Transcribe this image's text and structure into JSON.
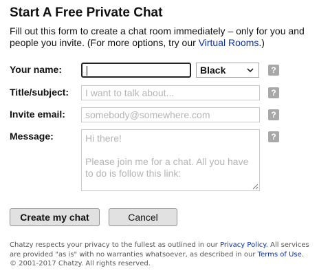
{
  "header": {
    "title": "Start A Free Private Chat",
    "intro_text": "Fill out this form to create a chat room immediately – only for you and people you invite. (For more options, try our ",
    "intro_link": "Virtual Rooms",
    "intro_end": ".)"
  },
  "form": {
    "name": {
      "label": "Your name:",
      "value": ""
    },
    "color": {
      "selected": "Black"
    },
    "title": {
      "label": "Title/subject:",
      "placeholder": "I want to talk about..."
    },
    "invite": {
      "label": "Invite email:",
      "placeholder": "somebody@somewhere.com"
    },
    "message": {
      "label": "Message:",
      "placeholder_line1": "Hi there!",
      "placeholder_line2": "Please join me for a chat. All you have to do is follow this link:"
    },
    "help_glyph": "?"
  },
  "actions": {
    "create_label": "Create my chat",
    "cancel_label": "Cancel"
  },
  "footer": {
    "text1": "Chatzy respects your privacy to the fullest as outlined in our ",
    "privacy_link": "Privacy Policy",
    "text2": ". All services are provided \"as is\" with no warranties whatsoever, as described in our ",
    "terms_link": "Terms of Use",
    "text3": ". © 2001-2017 Chatzy. All rights reserved."
  },
  "colors": {
    "link": "#0a2fa0",
    "help_badge": "#a8a8a8",
    "button_bg": "#e1e1e1",
    "placeholder": "#b4b4b4"
  },
  "icons": {
    "help": "question-mark-icon",
    "select_arrow": "chevron-down-icon",
    "resize": "resize-grip-icon"
  }
}
